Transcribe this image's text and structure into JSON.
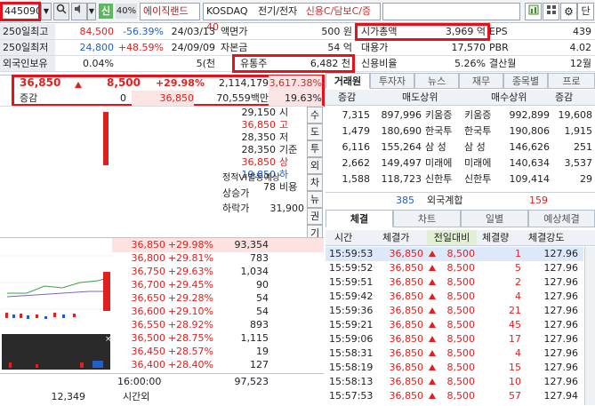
{
  "toolbar": {
    "code": "445090",
    "badge": "신",
    "margin": "40%",
    "name": "에이직랜드",
    "market": "KOSDAQ",
    "sector": "전기/전자",
    "credit": "신용C/담보C/증40",
    "btn_right": "단"
  },
  "info": {
    "rows": [
      {
        "label": "250일최고",
        "value": "84,500",
        "pct": "-56.39%",
        "date": "24/03/13",
        "label2": "액면가",
        "value2": "500 원",
        "label3": "시가총액",
        "value3": "3,969 억",
        "label4": "EPS",
        "value4": "439"
      },
      {
        "label": "250일최저",
        "value": "24,800",
        "pct": "+48.59%",
        "date": "24/09/09",
        "label2": "자본금",
        "value2": "54 억",
        "label3": "대용가",
        "value3": "17,570",
        "label4": "PBR",
        "value4": "4.02"
      },
      {
        "label": "외국인보유",
        "value": "0.04%",
        "pct": "",
        "date": "5(천",
        "label2": "유통주",
        "value2": "6,482 천",
        "label3": "신용비율",
        "value3": "5.26%",
        "label4": "결산월",
        "value4": "12월"
      }
    ]
  },
  "quote": {
    "price": "36,850",
    "change": "8,500",
    "change_pct": "+29.98%",
    "volume": "2,114,179",
    "vol_ratio": "3,617.38%",
    "row2_label": "증감",
    "row2_a": "0",
    "row2_b": "36,850",
    "row2_c": "70,559백만",
    "row2_d": "19.63%"
  },
  "price_side": {
    "items": [
      {
        "v": "29,150",
        "l": "시"
      },
      {
        "v": "36,850",
        "l": "고"
      },
      {
        "v": "28,350",
        "l": "저"
      },
      {
        "v": "28,350",
        "l": "기준"
      },
      {
        "v": "36,850",
        "l": "상"
      },
      {
        "v": "19,850",
        "l": "하"
      },
      {
        "v": "78",
        "l": "비용"
      }
    ],
    "vi_label": "정적VI발동예상",
    "up_label": "상승가",
    "down_label": "하락가",
    "down_value": "31,900",
    "side_buttons": [
      "수",
      "도",
      "투",
      "외",
      "차",
      "뉴",
      "권",
      "기"
    ]
  },
  "orderbook": {
    "rows": [
      {
        "price": "36,850",
        "pct": "+29.98%",
        "qty": "93,354"
      },
      {
        "price": "36,800",
        "pct": "+29.81%",
        "qty": "783"
      },
      {
        "price": "36,750",
        "pct": "+29.63%",
        "qty": "1,034"
      },
      {
        "price": "36,700",
        "pct": "+29.45%",
        "qty": "90"
      },
      {
        "price": "36,650",
        "pct": "+29.28%",
        "qty": "54"
      },
      {
        "price": "36,600",
        "pct": "+29.10%",
        "qty": "54"
      },
      {
        "price": "36,550",
        "pct": "+28.92%",
        "qty": "893"
      },
      {
        "price": "36,500",
        "pct": "+28.75%",
        "qty": "1,115"
      },
      {
        "price": "36,450",
        "pct": "+28.57%",
        "qty": "19"
      },
      {
        "price": "36,400",
        "pct": "+28.40%",
        "qty": "127"
      }
    ],
    "time": "16:00:00",
    "time_label": "시간외",
    "bottom_left": "12,349",
    "bottom_right": "97,523"
  },
  "broker": {
    "tabs": [
      "거래원",
      "투자자",
      "뉴스",
      "재무",
      "종목별",
      "프로"
    ],
    "col_sell": "매도상위",
    "col_buy": "매수상위",
    "col_inc": "증감",
    "rows": [
      {
        "inc": "7,315",
        "sell_qty": "897,996",
        "sell_name": "키움증",
        "buy_name": "키움증",
        "buy_qty": "992,899",
        "inc2": "19,608"
      },
      {
        "inc": "1,479",
        "sell_qty": "180,690",
        "sell_name": "한국투",
        "buy_name": "한국투",
        "buy_qty": "190,806",
        "inc2": "1,915"
      },
      {
        "inc": "6,116",
        "sell_qty": "155,264",
        "sell_name": "삼 성",
        "buy_name": "삼 성",
        "buy_qty": "146,626",
        "inc2": "251"
      },
      {
        "inc": "2,662",
        "sell_qty": "149,497",
        "sell_name": "미래에",
        "buy_name": "미래에",
        "buy_qty": "140,634",
        "inc2": "3,537"
      },
      {
        "inc": "1,588",
        "sell_qty": "118,723",
        "sell_name": "신한투",
        "buy_name": "신한투",
        "buy_qty": "109,414",
        "inc2": "29"
      }
    ],
    "foreign_label": "외국계합",
    "foreign_sell": "385",
    "foreign_buy": "159"
  },
  "trades": {
    "tabs": [
      "체결",
      "차트",
      "일별",
      "예상체결"
    ],
    "headers": [
      "시간",
      "체결가",
      "전일대비",
      "체결량",
      "체결강도"
    ],
    "rows": [
      {
        "t": "15:59:53",
        "p": "36,850",
        "c": "8,500",
        "q": "1",
        "s": "127.96"
      },
      {
        "t": "15:59:52",
        "p": "36,850",
        "c": "8,500",
        "q": "5",
        "s": "127.96"
      },
      {
        "t": "15:59:51",
        "p": "36,850",
        "c": "8,500",
        "q": "2",
        "s": "127.96"
      },
      {
        "t": "15:59:42",
        "p": "36,850",
        "c": "8,500",
        "q": "4",
        "s": "127.96"
      },
      {
        "t": "15:59:36",
        "p": "36,850",
        "c": "8,500",
        "q": "21",
        "s": "127.96"
      },
      {
        "t": "15:59:21",
        "p": "36,850",
        "c": "8,500",
        "q": "45",
        "s": "127.96"
      },
      {
        "t": "15:59:06",
        "p": "36,850",
        "c": "8,500",
        "q": "17",
        "s": "127.96"
      },
      {
        "t": "15:58:31",
        "p": "36,850",
        "c": "8,500",
        "q": "4",
        "s": "127.96"
      },
      {
        "t": "15:58:19",
        "p": "36,850",
        "c": "8,500",
        "q": "15",
        "s": "127.96"
      },
      {
        "t": "15:58:13",
        "p": "36,850",
        "c": "8,500",
        "q": "10",
        "s": "127.96"
      },
      {
        "t": "15:57:53",
        "p": "36,850",
        "c": "8,500",
        "q": "57",
        "s": "127.94"
      }
    ]
  },
  "colors": {
    "up": "#e0201e",
    "down": "#1f5fc8",
    "highlight": "#e8101a"
  }
}
